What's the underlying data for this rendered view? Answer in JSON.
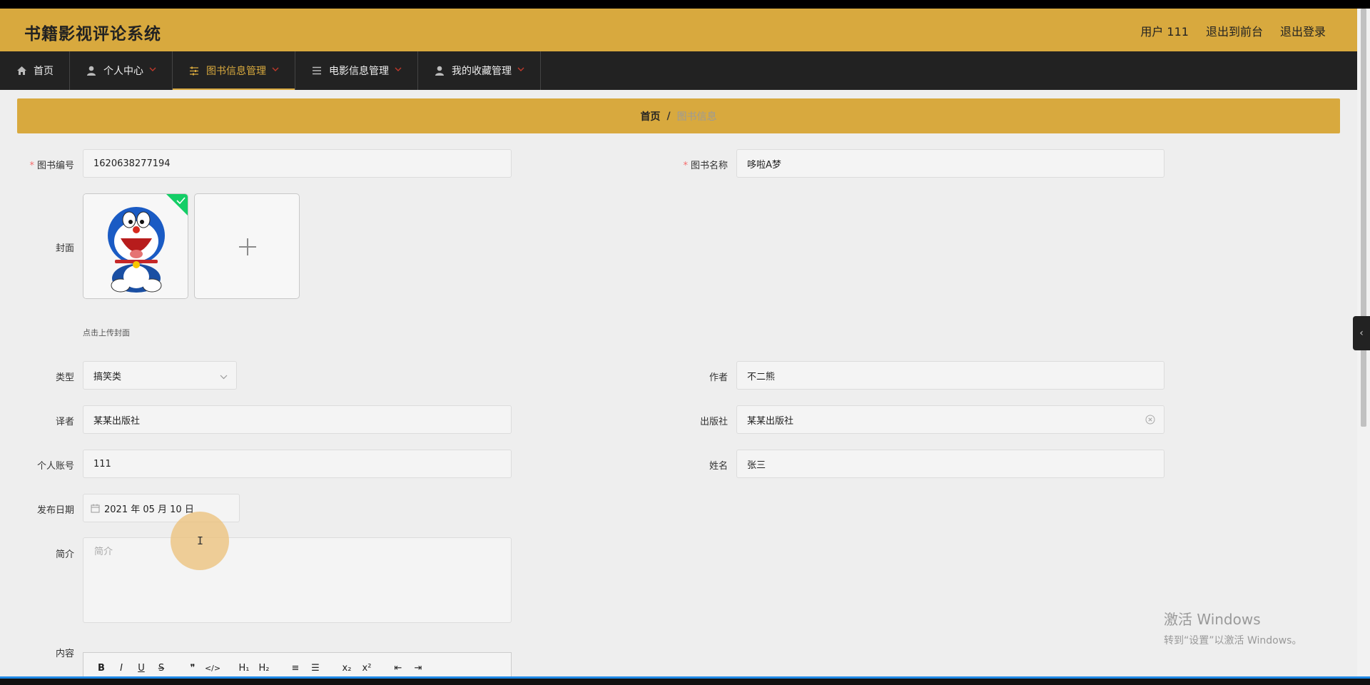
{
  "app": {
    "title": "书籍影视评论系统"
  },
  "top_links": {
    "user": "用户 111",
    "frontend": "退出到前台",
    "logout": "退出登录"
  },
  "nav": {
    "home": "首页",
    "personal": "个人中心",
    "books": "图书信息管理",
    "movies": "电影信息管理",
    "favorites": "我的收藏管理"
  },
  "breadcrumb": {
    "home": "首页",
    "sep": "/",
    "current": "图书信息"
  },
  "form": {
    "book_no": {
      "label": "图书编号",
      "value": "1620638277194"
    },
    "book_name": {
      "label": "图书名称",
      "value": "哆啦A梦"
    },
    "cover": {
      "label": "封面",
      "hint": "点击上传封面"
    },
    "type": {
      "label": "类型",
      "value": "搞笑类"
    },
    "author": {
      "label": "作者",
      "value": "不二熊"
    },
    "translator": {
      "label": "译者",
      "value": "某某出版社"
    },
    "publisher": {
      "label": "出版社",
      "value": "某某出版社"
    },
    "account": {
      "label": "个人账号",
      "value": "111"
    },
    "name": {
      "label": "姓名",
      "value": "张三"
    },
    "publish_date": {
      "label": "发布日期",
      "value": "2021 年 05 月 10 日"
    },
    "intro": {
      "label": "简介",
      "placeholder": "简介"
    },
    "content": {
      "label": "内容"
    }
  },
  "editor_toolbar": {
    "bold": "B",
    "italic": "I",
    "underline": "U",
    "strike": "S",
    "quote": "❞",
    "code": "</>",
    "h1": "H₁",
    "h2": "H₂",
    "ordered_list": "≡",
    "bullet_list": "☰",
    "subscript": "x₂",
    "superscript": "x²",
    "outdent": "⇤",
    "indent": "⇥"
  },
  "watermark": {
    "line1": "激活 Windows",
    "line2": "转到“设置”以激活 Windows。"
  },
  "colors": {
    "accent": "#d8a93e",
    "nav_bg": "#222222",
    "required": "#f56c6c",
    "success": "#13ce66"
  },
  "icons": [
    "home-icon",
    "user-icon",
    "sliders-icon",
    "list-icon",
    "user-icon",
    "plus-icon",
    "calendar-icon",
    "chevron-down-icon",
    "clear-icon",
    "check-icon"
  ]
}
